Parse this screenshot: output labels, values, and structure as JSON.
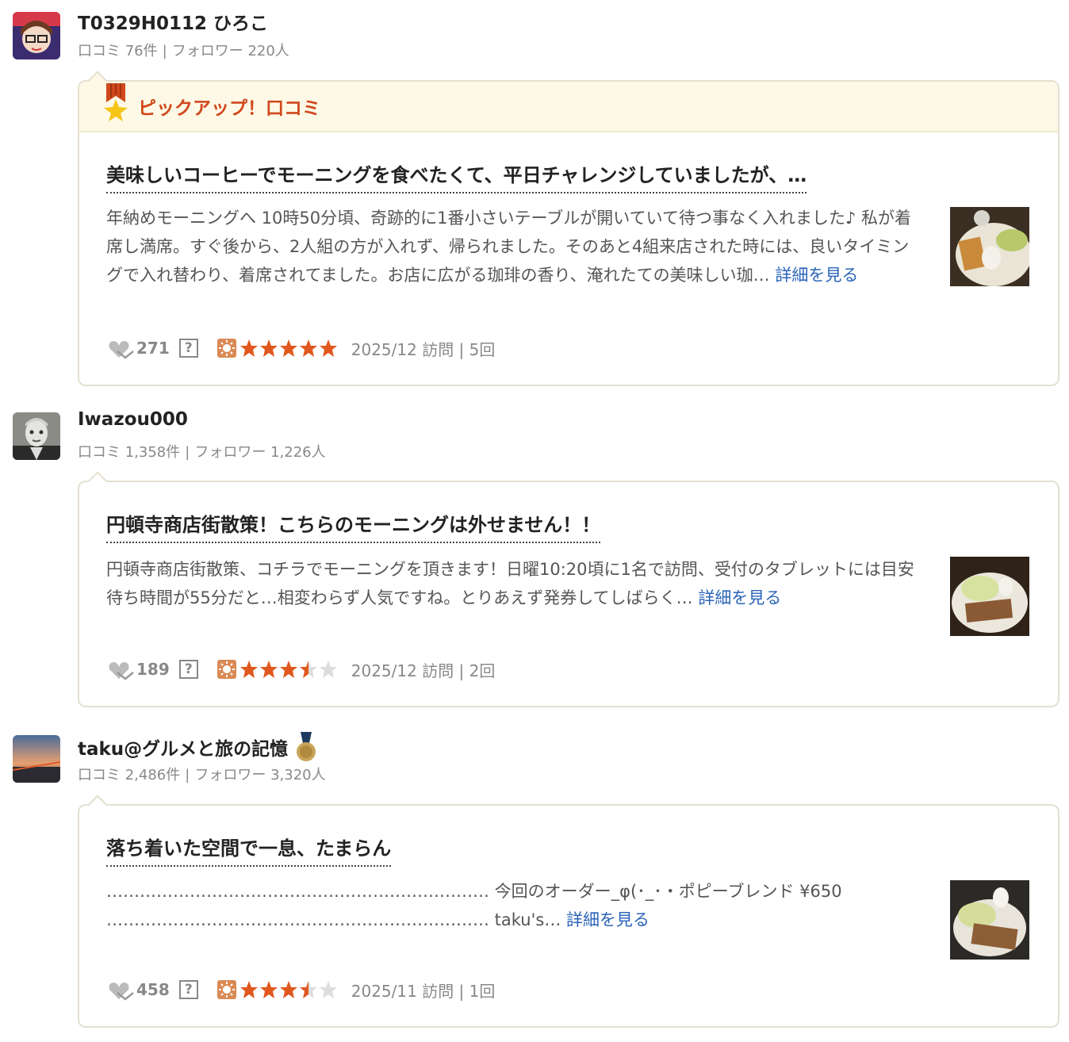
{
  "colors": {
    "accent_orange": "#d0481b",
    "star_full": "#e0581e",
    "link": "#2a64b8",
    "card_border": "#e4e0cf",
    "pickup_bg": "#fdf9e6"
  },
  "reviews": [
    {
      "user": {
        "name": "T0329H0112 ひろこ",
        "reviews_label": "口コミ 76件",
        "followers_label": "フォロワー 220人",
        "avatar_icon": "glasses-avatar"
      },
      "pickup_label": "ピックアップ！口コミ",
      "title": "美味しいコーヒーでモーニングを食べたくて、平日チャレンジしていましたが、…",
      "body": "年納めモーニングへ 10時50分頃、奇跡的に1番小さいテーブルが開いていて待つ事なく入れました♪ 私が着席し満席。すぐ後から、2人組の方が入れず、帰られました。そのあと4組来店された時には、良いタイミングで入れ替わり、着席されてました。お店に広がる珈琲の香り、淹れたての美味しい珈…",
      "more_label": "詳細を見る",
      "likes": "271",
      "help": "?",
      "rating": 5,
      "visit": "2025/12 訪問 | 5回"
    },
    {
      "user": {
        "name": "Iwazou000",
        "reviews_label": "口コミ 1,358件",
        "followers_label": "フォロワー 1,226人",
        "avatar_icon": "statue-avatar"
      },
      "title": "円頓寺商店街散策！こちらのモーニングは外せません！！",
      "body": "円頓寺商店街散策、コチラでモーニングを頂きます！日曜10:20頃に1名で訪問、受付のタブレットには目安待ち時間が55分だと…相変わらず人気ですね。とりあえず発券してしばらく…",
      "more_label": "詳細を見る",
      "likes": "189",
      "help": "?",
      "rating": 3.5,
      "visit": "2025/12 訪問 | 2回"
    },
    {
      "user": {
        "name": "taku@グルメと旅の記憶",
        "reviews_label": "口コミ 2,486件",
        "followers_label": "フォロワー 3,320人",
        "avatar_icon": "sunset-avatar",
        "badge_icon": "medal-icon"
      },
      "title": "落ち着いた空間で一息、たまらん",
      "body_line1": "…………………………………………………………… 今回のオーダー_φ(･_･・ポピーブレンド ¥650",
      "body_line2": "…………………………………………………………… taku's…",
      "more_label": "詳細を見る",
      "likes": "458",
      "help": "?",
      "rating": 3.5,
      "visit": "2025/11 訪問 | 1回"
    }
  ]
}
